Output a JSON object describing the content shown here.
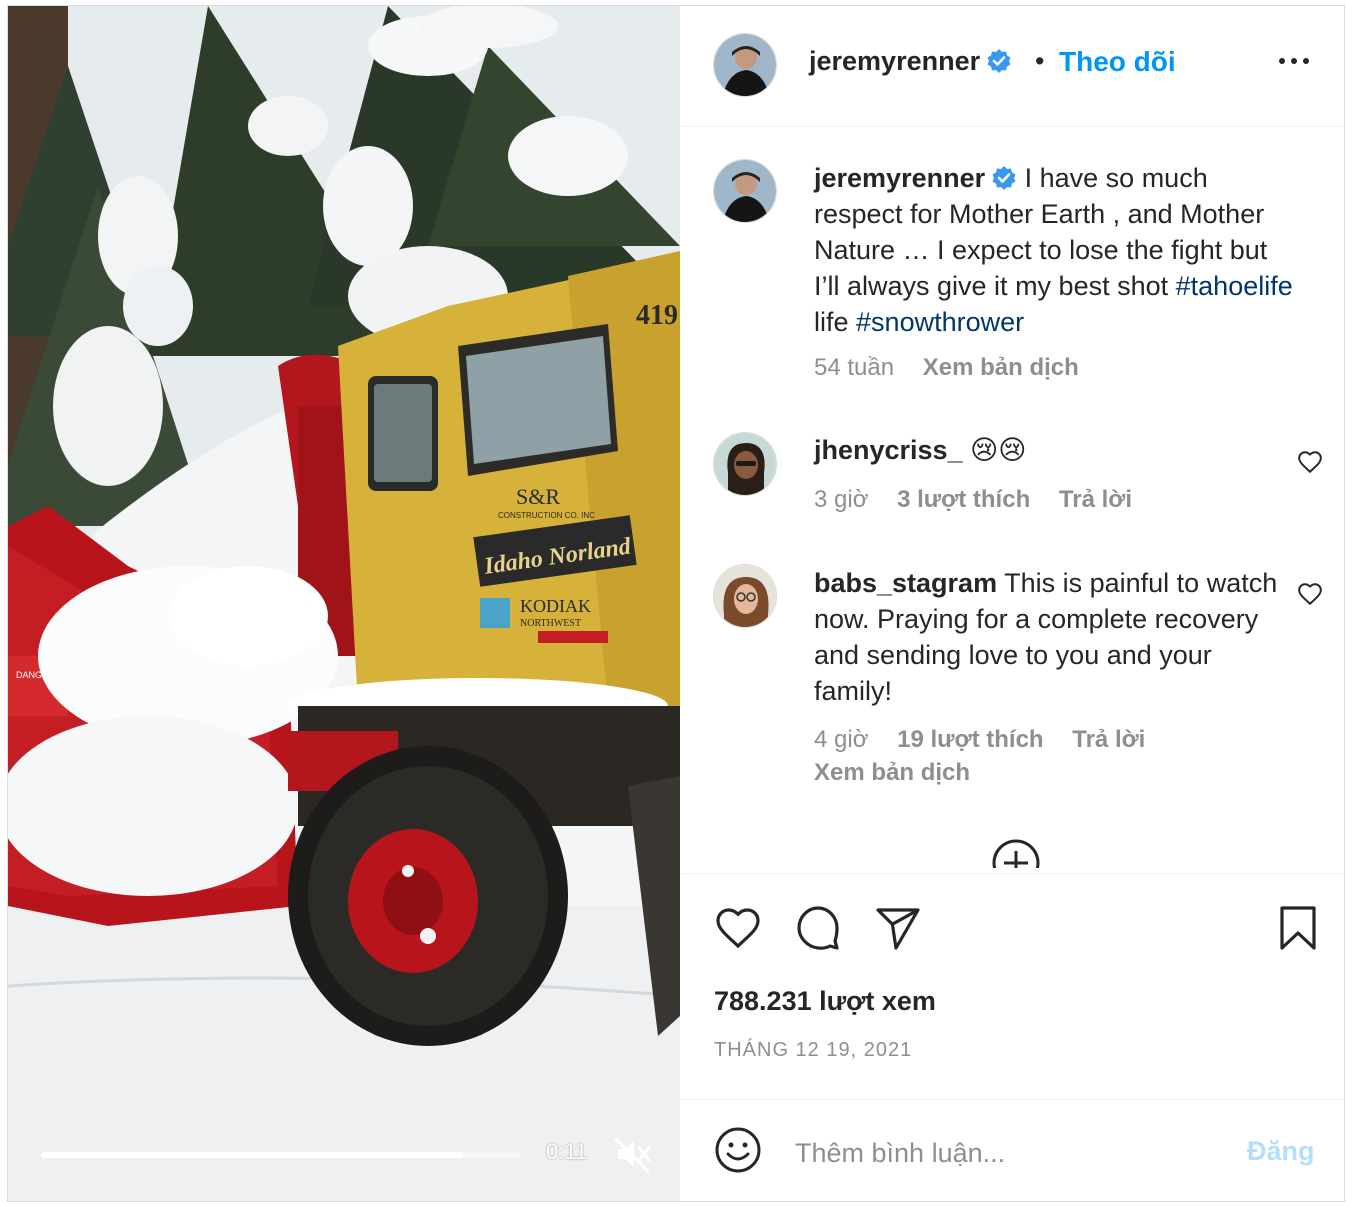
{
  "post": {
    "username": "jeremyrenner",
    "separator": "•",
    "follow_label": "Theo dõi",
    "more_icon": "more-horizontal-icon"
  },
  "video": {
    "time": "0:11",
    "progress": 0.88,
    "muted": true,
    "vehicle_text": {
      "number": "419",
      "company": "S&R",
      "company_sub": "CONSTRUCTION CO. INC",
      "name_plate": "Idaho Norland",
      "brand": "KODIAK",
      "brand_sub": "NORTHWEST",
      "warning": "DANGER"
    }
  },
  "caption": {
    "username": "jeremyrenner",
    "text": "I have so much respect for Mother Earth , and Mother Nature … I expect to lose the fight but I’ll always give it my best shot",
    "hashtag1": "#tahoelife",
    "between": "life",
    "hashtag2": "#snowthrower",
    "age": "54 tuần",
    "translate": "Xem bản dịch"
  },
  "comments": [
    {
      "username": "jhenycriss_",
      "text": "😢😢",
      "age": "3 giờ",
      "likes": "3 lượt thích",
      "reply": "Trả lời"
    },
    {
      "username": "babs_stagram",
      "text": "This is painful to watch now. Praying for a complete recovery and sending love to you and your family!",
      "age": "4 giờ",
      "likes": "19 lượt thích",
      "reply": "Trả lời",
      "translate": "Xem bản dịch"
    }
  ],
  "stats": {
    "views": "788.231 lượt xem",
    "date": "THÁNG 12 19, 2021"
  },
  "composer": {
    "placeholder": "Thêm bình luận...",
    "post_label": "Đăng"
  },
  "colors": {
    "link_blue": "#0095f6",
    "hashtag": "#00376b",
    "muted_text": "#8e8e8e",
    "post_disabled": "#b2dffc",
    "verified": "#3897f0"
  }
}
